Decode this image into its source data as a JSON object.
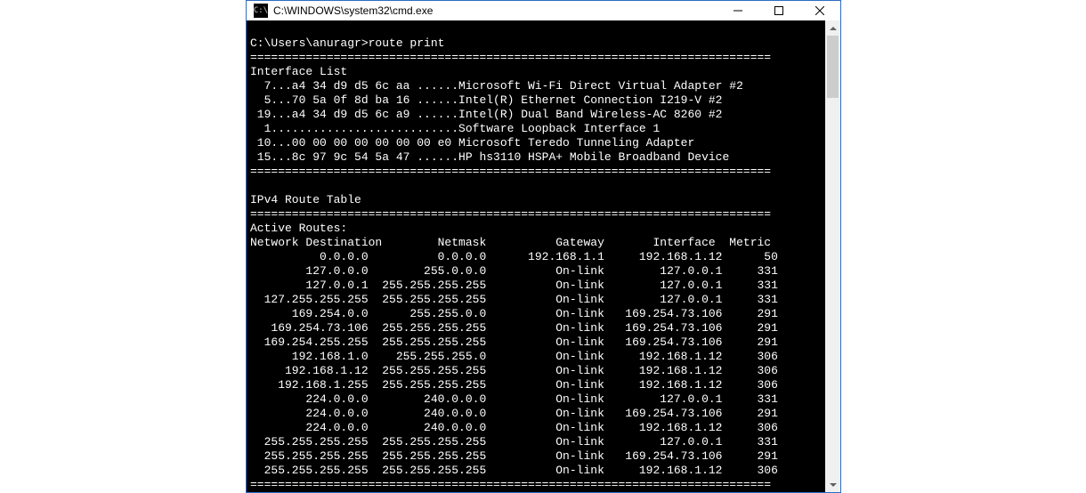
{
  "window": {
    "title": "C:\\WINDOWS\\system32\\cmd.exe",
    "icon_label": "C:\\"
  },
  "console": {
    "prompt": "C:\\Users\\anuragr>",
    "command": "route print",
    "sep": "===========================================================================",
    "interface_list_header": "Interface List",
    "interfaces": [
      {
        "line": "  7...a4 34 d9 d5 6c aa ......Microsoft Wi-Fi Direct Virtual Adapter #2"
      },
      {
        "line": "  5...70 5a 0f 8d ba 16 ......Intel(R) Ethernet Connection I219-V #2"
      },
      {
        "line": " 19...a4 34 d9 d5 6c a9 ......Intel(R) Dual Band Wireless-AC 8260 #2"
      },
      {
        "line": "  1...........................Software Loopback Interface 1"
      },
      {
        "line": " 10...00 00 00 00 00 00 00 e0 Microsoft Teredo Tunneling Adapter"
      },
      {
        "line": " 15...8c 97 9c 54 5a 47 ......HP hs3110 HSPA+ Mobile Broadband Device"
      }
    ],
    "ipv4_header": "IPv4 Route Table",
    "active_routes_header": "Active Routes:",
    "columns": {
      "dest": "Network Destination",
      "netmask": "Netmask",
      "gateway": "Gateway",
      "interface": "Interface",
      "metric": "Metric"
    },
    "routes": [
      {
        "dest": "0.0.0.0",
        "netmask": "0.0.0.0",
        "gateway": "192.168.1.1",
        "interface": "192.168.1.12",
        "metric": "50"
      },
      {
        "dest": "127.0.0.0",
        "netmask": "255.0.0.0",
        "gateway": "On-link",
        "interface": "127.0.0.1",
        "metric": "331"
      },
      {
        "dest": "127.0.0.1",
        "netmask": "255.255.255.255",
        "gateway": "On-link",
        "interface": "127.0.0.1",
        "metric": "331"
      },
      {
        "dest": "127.255.255.255",
        "netmask": "255.255.255.255",
        "gateway": "On-link",
        "interface": "127.0.0.1",
        "metric": "331"
      },
      {
        "dest": "169.254.0.0",
        "netmask": "255.255.0.0",
        "gateway": "On-link",
        "interface": "169.254.73.106",
        "metric": "291"
      },
      {
        "dest": "169.254.73.106",
        "netmask": "255.255.255.255",
        "gateway": "On-link",
        "interface": "169.254.73.106",
        "metric": "291"
      },
      {
        "dest": "169.254.255.255",
        "netmask": "255.255.255.255",
        "gateway": "On-link",
        "interface": "169.254.73.106",
        "metric": "291"
      },
      {
        "dest": "192.168.1.0",
        "netmask": "255.255.255.0",
        "gateway": "On-link",
        "interface": "192.168.1.12",
        "metric": "306"
      },
      {
        "dest": "192.168.1.12",
        "netmask": "255.255.255.255",
        "gateway": "On-link",
        "interface": "192.168.1.12",
        "metric": "306"
      },
      {
        "dest": "192.168.1.255",
        "netmask": "255.255.255.255",
        "gateway": "On-link",
        "interface": "192.168.1.12",
        "metric": "306"
      },
      {
        "dest": "224.0.0.0",
        "netmask": "240.0.0.0",
        "gateway": "On-link",
        "interface": "127.0.0.1",
        "metric": "331"
      },
      {
        "dest": "224.0.0.0",
        "netmask": "240.0.0.0",
        "gateway": "On-link",
        "interface": "169.254.73.106",
        "metric": "291"
      },
      {
        "dest": "224.0.0.0",
        "netmask": "240.0.0.0",
        "gateway": "On-link",
        "interface": "192.168.1.12",
        "metric": "306"
      },
      {
        "dest": "255.255.255.255",
        "netmask": "255.255.255.255",
        "gateway": "On-link",
        "interface": "127.0.0.1",
        "metric": "331"
      },
      {
        "dest": "255.255.255.255",
        "netmask": "255.255.255.255",
        "gateway": "On-link",
        "interface": "169.254.73.106",
        "metric": "291"
      },
      {
        "dest": "255.255.255.255",
        "netmask": "255.255.255.255",
        "gateway": "On-link",
        "interface": "192.168.1.12",
        "metric": "306"
      }
    ]
  }
}
